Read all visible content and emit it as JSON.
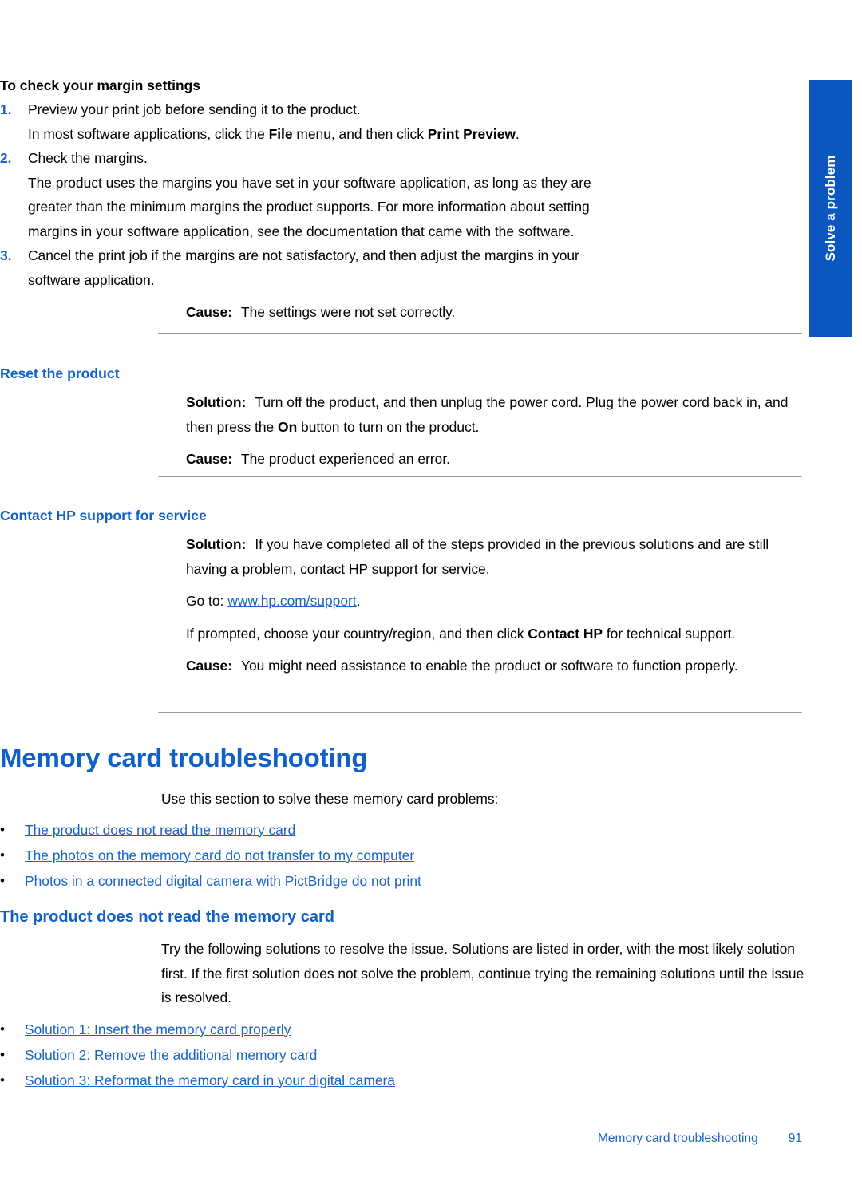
{
  "side_tab": {
    "label": "Solve a problem",
    "color": "#0b57bf"
  },
  "colors": {
    "heading_blue": "#1060c8",
    "link_blue": "#1763c6",
    "rule_gray": "#9a9a9a"
  },
  "margin_procedure": {
    "title": "To check your margin settings",
    "steps": [
      {
        "num": "1.",
        "lines": [
          {
            "parts": [
              {
                "text": "Preview your print job before sending it to the product.",
                "bold": false
              }
            ]
          },
          {
            "parts": [
              {
                "text": "In most software applications, click the ",
                "bold": false
              },
              {
                "text": "File",
                "bold": true
              },
              {
                "text": " menu, and then click ",
                "bold": false
              },
              {
                "text": "Print Preview",
                "bold": true
              },
              {
                "text": ".",
                "bold": false
              }
            ]
          }
        ]
      },
      {
        "num": "2.",
        "lines": [
          {
            "parts": [
              {
                "text": "Check the margins.",
                "bold": false
              }
            ]
          },
          {
            "parts": [
              {
                "text": "The product uses the margins you have set in your software application, as long as they are greater than the minimum margins the product supports. For more information about setting margins in your software application, see the documentation that came with the software.",
                "bold": false
              }
            ]
          }
        ]
      },
      {
        "num": "3.",
        "lines": [
          {
            "parts": [
              {
                "text": "Cancel the print job if the margins are not satisfactory, and then adjust the margins in your software application.",
                "bold": false
              }
            ]
          }
        ]
      }
    ],
    "cause_label": "Cause:",
    "cause_text": "The settings were not set correctly."
  },
  "reset_product": {
    "heading": "Reset the product",
    "solution_label": "Solution:",
    "solution_parts": [
      {
        "text": "Turn off the product, and then unplug the power cord. Plug the power cord back in, and then press the ",
        "bold": false
      },
      {
        "text": "On",
        "bold": true
      },
      {
        "text": " button to turn on the product.",
        "bold": false
      }
    ],
    "cause_label": "Cause:",
    "cause_text": "The product experienced an error."
  },
  "contact_hp": {
    "heading": "Contact HP support for service",
    "solution_label": "Solution:",
    "solution_text": "If you have completed all of the steps provided in the previous solutions and are still having a problem, contact HP support for service.",
    "goto_prefix": "Go to: ",
    "goto_link": "www.hp.com/support",
    "goto_suffix": ".",
    "prompt_parts": [
      {
        "text": "If prompted, choose your country/region, and then click ",
        "bold": false
      },
      {
        "text": "Contact HP",
        "bold": true
      },
      {
        "text": " for technical support.",
        "bold": false
      }
    ],
    "cause_label": "Cause:",
    "cause_text": "You might need assistance to enable the product or software to function properly."
  },
  "memory_card_section": {
    "title": "Memory card troubleshooting",
    "intro": "Use this section to solve these memory card problems:",
    "links": [
      "The product does not read the memory card",
      "The photos on the memory card do not transfer to my computer",
      "Photos in a connected digital camera with PictBridge do not print"
    ]
  },
  "not_read_section": {
    "heading": "The product does not read the memory card",
    "intro": "Try the following solutions to resolve the issue. Solutions are listed in order, with the most likely solution first. If the first solution does not solve the problem, continue trying the remaining solutions until the issue is resolved.",
    "links": [
      "Solution 1: Insert the memory card properly",
      "Solution 2: Remove the additional memory card",
      "Solution 3: Reformat the memory card in your digital camera"
    ]
  },
  "footer": {
    "title": "Memory card troubleshooting",
    "page_number": "91"
  }
}
